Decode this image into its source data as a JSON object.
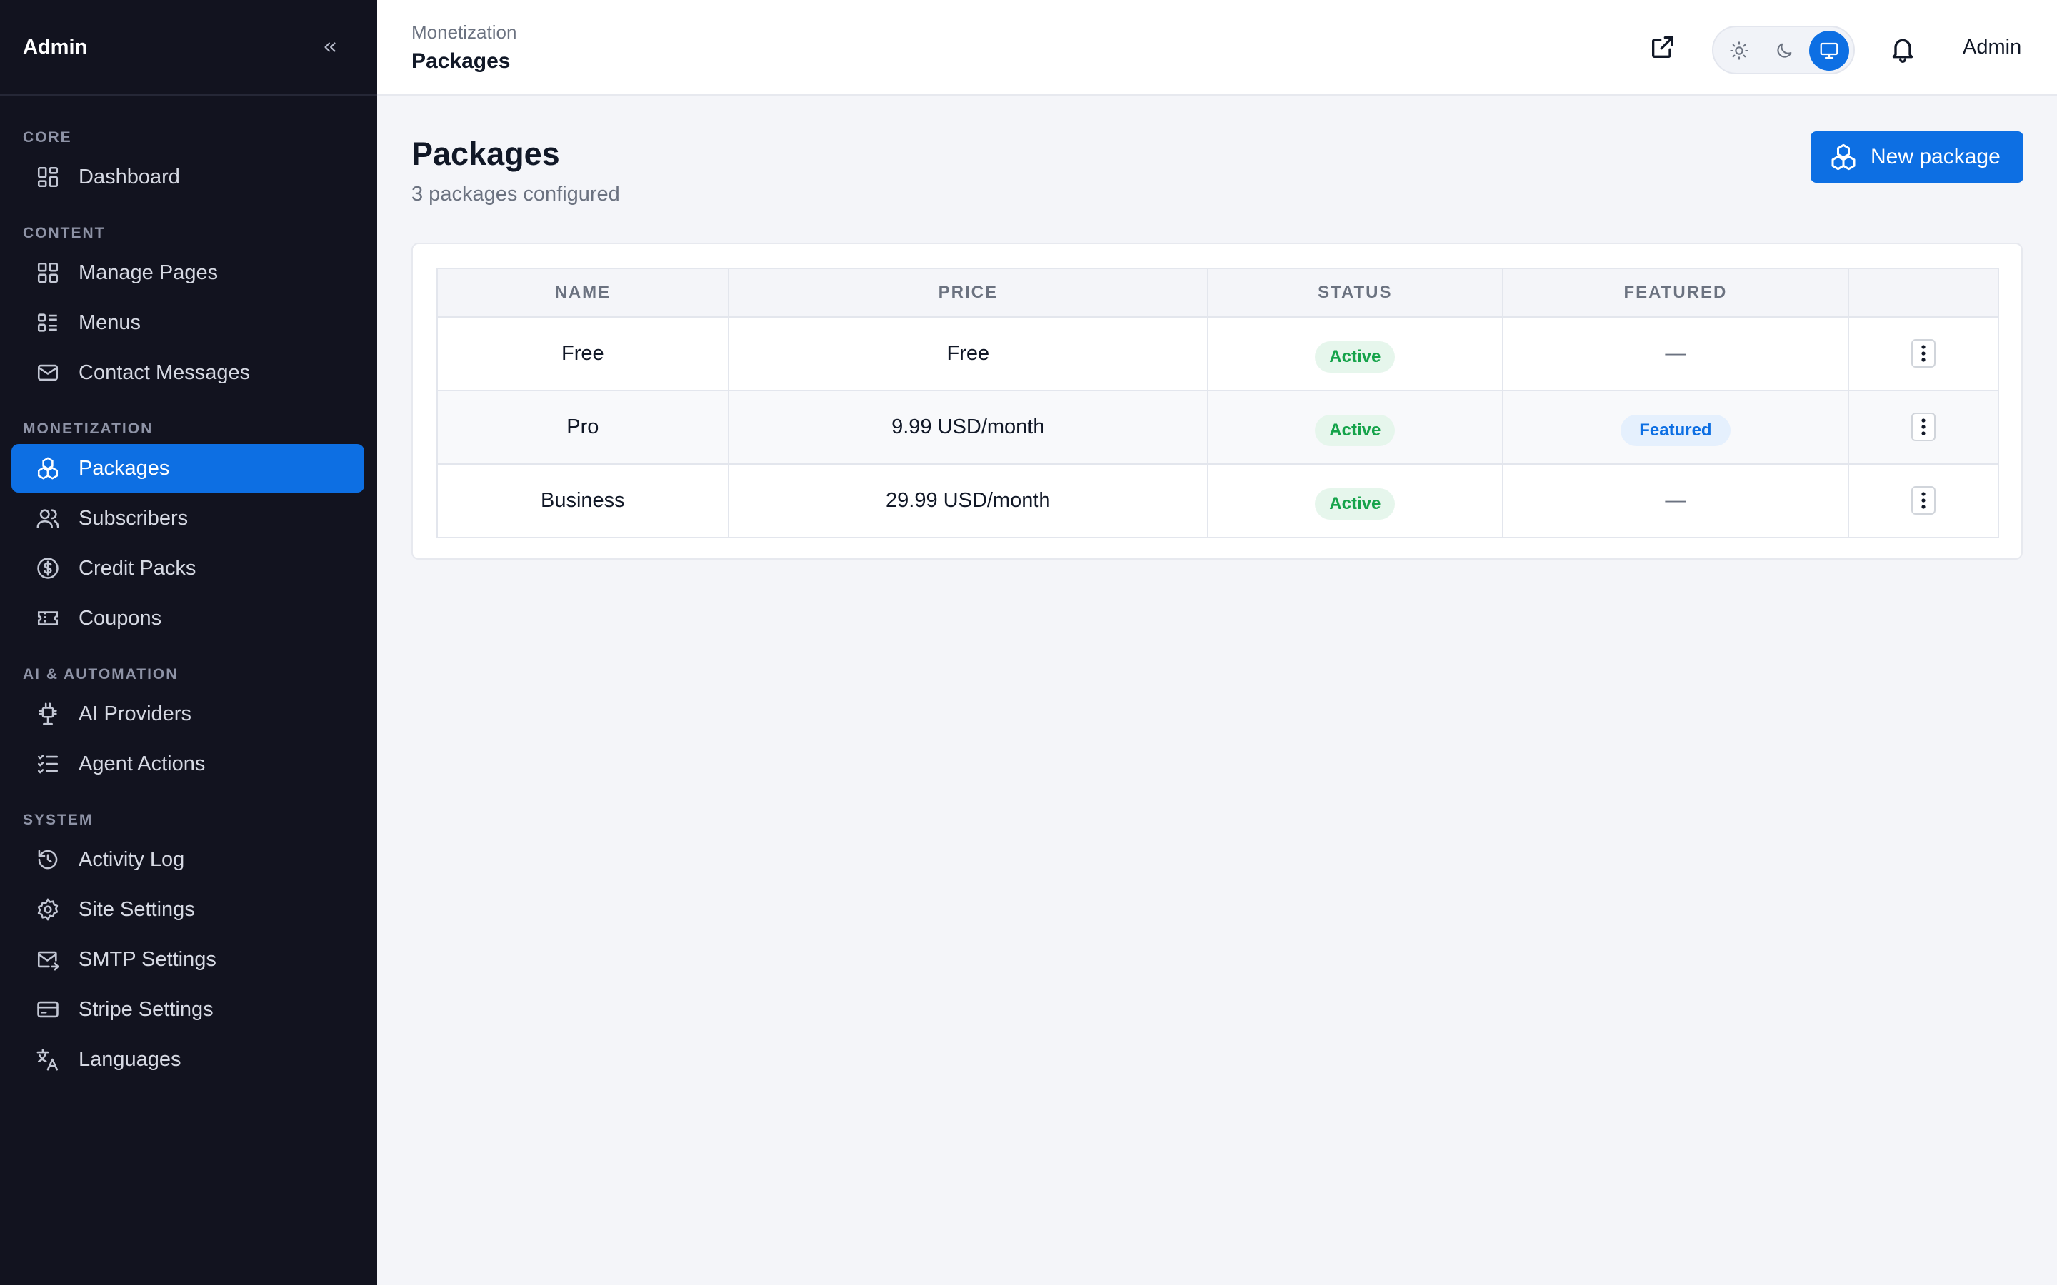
{
  "sidebar": {
    "title": "Admin",
    "sections": [
      {
        "title": "CORE",
        "items": [
          {
            "label": "Dashboard",
            "icon": "dashboard-icon"
          }
        ]
      },
      {
        "title": "CONTENT",
        "items": [
          {
            "label": "Manage Pages",
            "icon": "pages-icon"
          },
          {
            "label": "Menus",
            "icon": "menu-list-icon"
          },
          {
            "label": "Contact Messages",
            "icon": "mail-icon"
          }
        ]
      },
      {
        "title": "MONETIZATION",
        "items": [
          {
            "label": "Packages",
            "icon": "packages-icon",
            "active": true
          },
          {
            "label": "Subscribers",
            "icon": "users-icon"
          },
          {
            "label": "Credit Packs",
            "icon": "dollar-circle-icon"
          },
          {
            "label": "Coupons",
            "icon": "ticket-icon"
          }
        ]
      },
      {
        "title": "AI & AUTOMATION",
        "items": [
          {
            "label": "AI Providers",
            "icon": "chip-icon"
          },
          {
            "label": "Agent Actions",
            "icon": "checklist-icon"
          }
        ]
      },
      {
        "title": "SYSTEM",
        "items": [
          {
            "label": "Activity Log",
            "icon": "history-icon"
          },
          {
            "label": "Site Settings",
            "icon": "gear-icon"
          },
          {
            "label": "SMTP Settings",
            "icon": "mail-send-icon"
          },
          {
            "label": "Stripe Settings",
            "icon": "credit-card-icon"
          },
          {
            "label": "Languages",
            "icon": "translate-icon"
          }
        ]
      }
    ]
  },
  "header": {
    "breadcrumb_parent": "Monetization",
    "breadcrumb_current": "Packages",
    "theme_selected": "system",
    "user": "Admin"
  },
  "main": {
    "title": "Packages",
    "subtitle": "3 packages configured",
    "new_button": "New package",
    "table": {
      "columns": [
        "NAME",
        "PRICE",
        "STATUS",
        "FEATURED",
        ""
      ],
      "rows": [
        {
          "name": "Free",
          "price": "Free",
          "status": "Active",
          "featured": "—"
        },
        {
          "name": "Pro",
          "price": "9.99 USD/month",
          "status": "Active",
          "featured": "Featured"
        },
        {
          "name": "Business",
          "price": "29.99 USD/month",
          "status": "Active",
          "featured": "—"
        }
      ]
    }
  },
  "colors": {
    "accent": "#0d6fe3",
    "sidebar_bg": "#12131f",
    "active_green": "#15a34a"
  }
}
